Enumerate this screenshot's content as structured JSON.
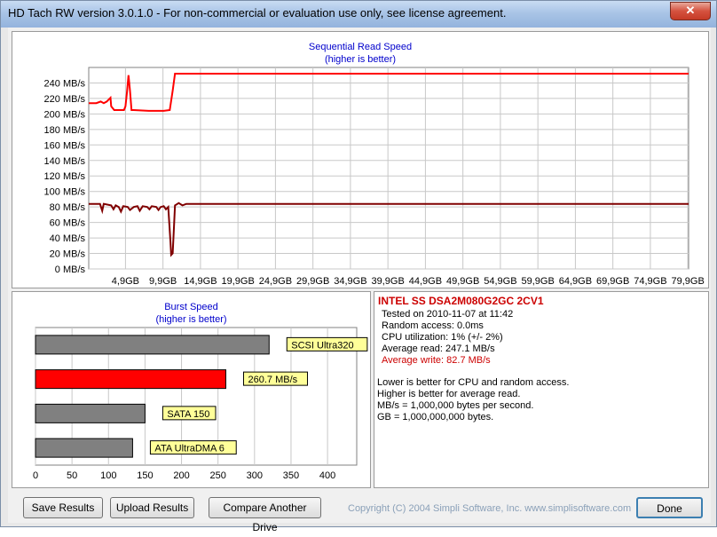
{
  "window": {
    "title": "HD Tach RW version 3.0.1.0  - For non-commercial or evaluation use only, see license agreement.",
    "close_glyph": "✕"
  },
  "seq_chart": {
    "title": "Sequential Read Speed",
    "subtitle": "(higher is better)"
  },
  "burst_chart": {
    "title": "Burst Speed",
    "subtitle": "(higher is better)"
  },
  "chart_data": [
    {
      "type": "line",
      "title": "Sequential Read Speed",
      "subtitle": "(higher is better)",
      "ylim": [
        0,
        260
      ],
      "yticks": [
        0,
        20,
        40,
        60,
        80,
        100,
        120,
        140,
        160,
        180,
        200,
        220,
        240
      ],
      "ytick_labels": [
        "0 MB/s",
        "20 MB/s",
        "40 MB/s",
        "60 MB/s",
        "80 MB/s",
        "100 MB/s",
        "120 MB/s",
        "140 MB/s",
        "160 MB/s",
        "180 MB/s",
        "200 MB/s",
        "220 MB/s",
        "240 MB/s"
      ],
      "xlim": [
        0,
        80
      ],
      "xtick_labels": [
        "4,9GB",
        "9,9GB",
        "14,9GB",
        "19,9GB",
        "24,9GB",
        "29,9GB",
        "34,9GB",
        "39,9GB",
        "44,9GB",
        "49,9GB",
        "54,9GB",
        "59,9GB",
        "64,9GB",
        "69,9GB",
        "74,9GB",
        "79,9GB"
      ],
      "xtick_values": [
        4.9,
        9.9,
        14.9,
        19.9,
        24.9,
        29.9,
        34.9,
        39.9,
        44.9,
        49.9,
        54.9,
        59.9,
        64.9,
        69.9,
        74.9,
        79.9
      ],
      "grid": true,
      "series": [
        {
          "color": "#ff0000",
          "points": [
            [
              0,
              214
            ],
            [
              1,
              214
            ],
            [
              1.6,
              216
            ],
            [
              2,
              214
            ],
            [
              2.4,
              216
            ],
            [
              2.9,
              221
            ],
            [
              3,
              210
            ],
            [
              3.4,
              205
            ],
            [
              3.8,
              205
            ],
            [
              4.1,
              205
            ],
            [
              4.7,
              205
            ],
            [
              4.9,
              210
            ],
            [
              5.1,
              228
            ],
            [
              5.3,
              250
            ],
            [
              5.5,
              230
            ],
            [
              5.7,
              205
            ],
            [
              6,
              205
            ],
            [
              8,
              204
            ],
            [
              10,
              204
            ],
            [
              10.8,
              205
            ],
            [
              11.2,
              230
            ],
            [
              11.5,
              252
            ],
            [
              20,
              252
            ],
            [
              40,
              252
            ],
            [
              60,
              252
            ],
            [
              80,
              252
            ]
          ]
        },
        {
          "color": "#800000",
          "points": [
            [
              0,
              84
            ],
            [
              1.5,
              84
            ],
            [
              1.8,
              75
            ],
            [
              2,
              84
            ],
            [
              3,
              82
            ],
            [
              3.3,
              77
            ],
            [
              3.6,
              82
            ],
            [
              4,
              80
            ],
            [
              4.3,
              74
            ],
            [
              4.6,
              81
            ],
            [
              5.2,
              80
            ],
            [
              5.5,
              76
            ],
            [
              6,
              80
            ],
            [
              6.5,
              81
            ],
            [
              6.8,
              75
            ],
            [
              7.2,
              81
            ],
            [
              7.8,
              80
            ],
            [
              8.1,
              77
            ],
            [
              8.4,
              81
            ],
            [
              9,
              80
            ],
            [
              9.3,
              76
            ],
            [
              9.6,
              80
            ],
            [
              10,
              81
            ],
            [
              10.3,
              77
            ],
            [
              10.6,
              80
            ],
            [
              10.9,
              35
            ],
            [
              11,
              18
            ],
            [
              11.2,
              20
            ],
            [
              11.4,
              60
            ],
            [
              11.5,
              82
            ],
            [
              12,
              85
            ],
            [
              12.5,
              82
            ],
            [
              13,
              84
            ],
            [
              14,
              84
            ],
            [
              15,
              84
            ],
            [
              16,
              84
            ],
            [
              17,
              84
            ],
            [
              18,
              84
            ],
            [
              19,
              84
            ],
            [
              20,
              84
            ],
            [
              25,
              84
            ],
            [
              30,
              84
            ],
            [
              35,
              84
            ],
            [
              40,
              84
            ],
            [
              45,
              84
            ],
            [
              50,
              84
            ],
            [
              55,
              84
            ],
            [
              60,
              84
            ],
            [
              65,
              84
            ],
            [
              70,
              84
            ],
            [
              75,
              84
            ],
            [
              80,
              84
            ]
          ]
        }
      ]
    },
    {
      "type": "bar",
      "title": "Burst Speed",
      "subtitle": "(higher is better)",
      "orientation": "horizontal",
      "xlim": [
        0,
        440
      ],
      "xticks": [
        0,
        50,
        100,
        150,
        200,
        250,
        300,
        350,
        400
      ],
      "grid": true,
      "bars": [
        {
          "label": "SCSI Ultra320",
          "value": 320,
          "color": "#808080"
        },
        {
          "label": "260.7 MB/s",
          "value": 260.7,
          "color": "#ff0000"
        },
        {
          "label": "SATA 150",
          "value": 150,
          "color": "#808080"
        },
        {
          "label": "ATA UltraDMA 6",
          "value": 133,
          "color": "#808080"
        }
      ]
    }
  ],
  "info": {
    "drive": "INTEL SS DSA2M080G2GC 2CV1",
    "tested_on": "Tested on 2010-11-07 at 11:42",
    "random_access": "Random access: 0.0ms",
    "cpu": "CPU utilization: 1% (+/- 2%)",
    "avg_read": "Average read: 247.1 MB/s",
    "avg_write": "Average write: 82.7 MB/s",
    "note1": "Lower is better for CPU and random access.",
    "note2": "Higher is better for average read.",
    "note3": "MB/s = 1,000,000 bytes per second.",
    "note4": "GB = 1,000,000,000 bytes.",
    "drive_color": "#cc0000",
    "write_color": "#cc0000"
  },
  "buttons": {
    "save": "Save Results",
    "upload": "Upload Results",
    "compare": "Compare Another Drive",
    "done": "Done"
  },
  "copyright": "Copyright (C) 2004 Simpli Software, Inc. www.simplisoftware.com"
}
